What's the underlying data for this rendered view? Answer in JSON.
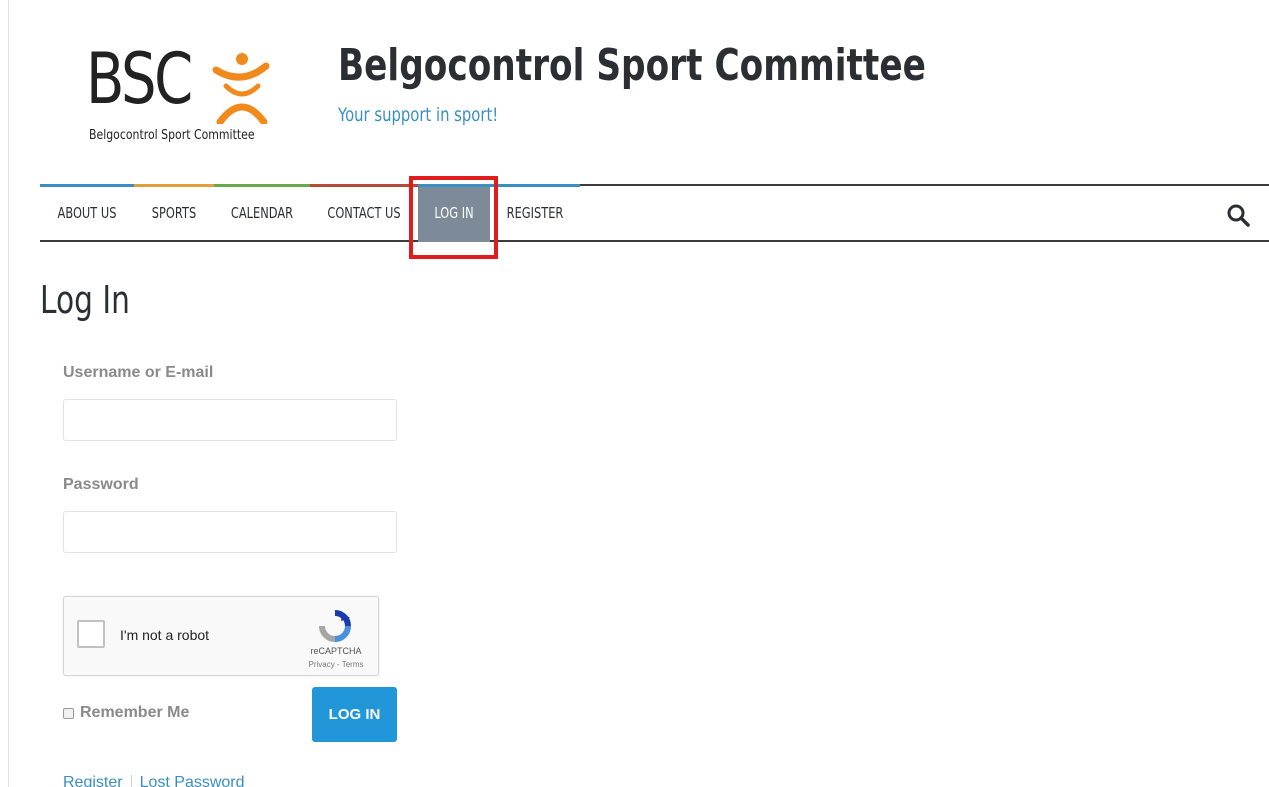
{
  "header": {
    "logo_text": "BSC",
    "logo_subtitle": "Belgocontrol Sport Committee",
    "site_title": "Belgocontrol Sport Committee",
    "tagline": "Your support in sport!"
  },
  "nav": {
    "items": [
      {
        "label": "ABOUT US",
        "accent": "#3a8fc2"
      },
      {
        "label": "SPORTS",
        "accent": "#e0a13a"
      },
      {
        "label": "CALENDAR",
        "accent": "#6aa84f"
      },
      {
        "label": "CONTACT US",
        "accent": "#b84a3a"
      },
      {
        "label": "LOG IN",
        "accent": "#3a8fc2",
        "active": true
      },
      {
        "label": "REGISTER",
        "accent": "#3a8fc2"
      }
    ],
    "search_icon": "search-icon"
  },
  "content": {
    "heading": "Log In",
    "username_label": "Username or E-mail",
    "username_value": "",
    "password_label": "Password",
    "password_value": "",
    "captcha": {
      "text": "I'm not a robot",
      "brand": "reCAPTCHA",
      "privacy": "Privacy",
      "terms": "Terms"
    },
    "remember_label": "Remember Me",
    "login_button": "LOG IN",
    "register_link": "Register",
    "lost_password_link": "Lost Password"
  },
  "colors": {
    "accent_blue": "#2196d8",
    "nav_active_bg": "#7d8b98",
    "highlight": "#e21c1c"
  }
}
